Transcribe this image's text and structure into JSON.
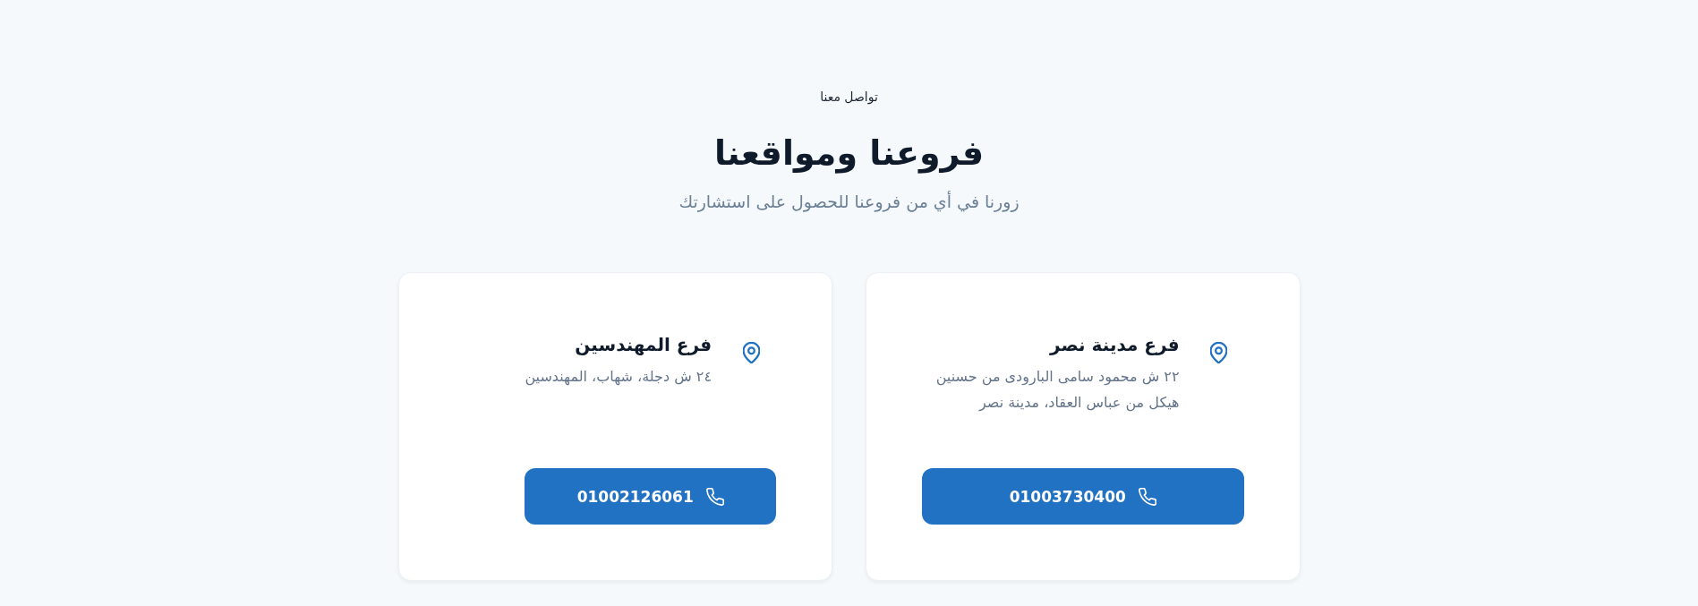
{
  "header": {
    "eyebrow": "تواصل معنا",
    "title": "فروعنا ومواقعنا",
    "subtitle": "زورنا في أي من فروعنا للحصول على استشارتك"
  },
  "branches": [
    {
      "name": "فرع مدينة نصر",
      "address": "٢٢ ش محمود سامى البارودى من حسنين هيكل من عباس العقاد، مدينة نصر",
      "phone": "01003730400"
    },
    {
      "name": "فرع المهندسين",
      "address": "٢٤ ش دجلة، شهاب، المهندسين",
      "phone": "01002126061"
    }
  ]
}
